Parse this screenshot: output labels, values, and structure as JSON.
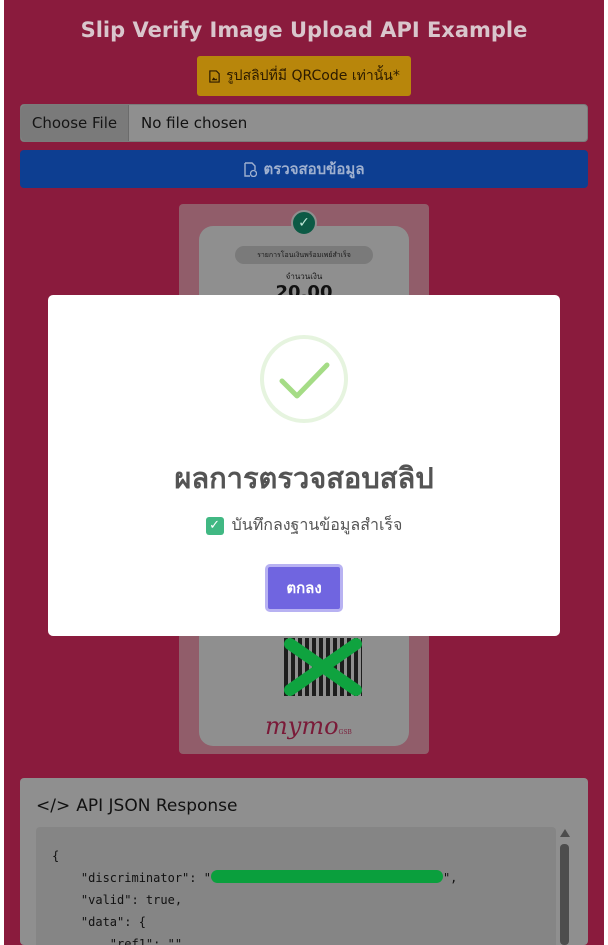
{
  "header": {
    "title": "Slip Verify Image Upload API Example",
    "note": "รูปสลิปที่มี QRCode เท่านั้น*"
  },
  "file_input": {
    "button_label": "Choose File",
    "status": "No file chosen"
  },
  "verify_button": {
    "label": "ตรวจสอบข้อมูล"
  },
  "slip_preview": {
    "status_pill": "รายการโอนเงินพร้อมเพย์สำเร็จ",
    "amount_label": "จำนวนเงิน",
    "amount": "20.00",
    "bank_logo": "mymo",
    "bank_logo_sub": "GSB"
  },
  "api_panel": {
    "title": "API JSON Response",
    "code_lines": [
      "{",
      "    \"discriminator\": \"",
      "    \"valid\": true,",
      "    \"data\": {",
      "        \"ref1\": \"\","
    ],
    "code_after_redaction": "\","
  },
  "modal": {
    "title": "ผลการตรวจสอบสลิป",
    "message": "บันทึกลงฐานข้อมูลสำเร็จ",
    "ok_label": "ตกลง"
  },
  "colors": {
    "page_bg": "#8a1b3d",
    "note_bg": "#b8860b",
    "verify_bg": "#0d3e91",
    "ok_button": "#7065e0",
    "success_check": "#a5dc86",
    "checkbox": "#41b883",
    "redaction": "#0a9f3d"
  },
  "icons": [
    "image-file-icon",
    "file-check-icon",
    "code-icon",
    "success-check-icon",
    "checkbox-checked-icon"
  ]
}
